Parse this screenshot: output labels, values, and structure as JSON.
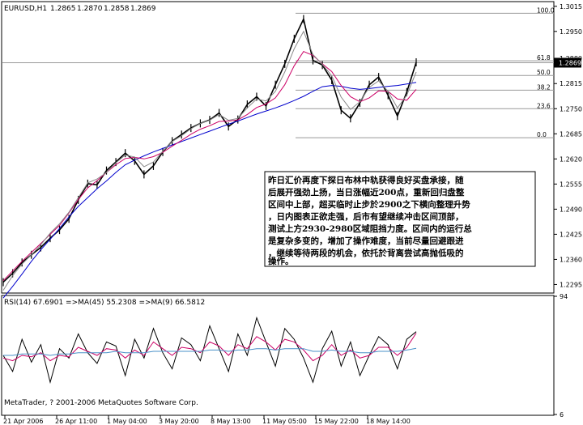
{
  "chart_data": [
    {
      "type": "candlestick",
      "panel": "price",
      "title": "EURUSD,H1",
      "ohlc_header": [
        "1.2865",
        "1.2870",
        "1.2858",
        "1.2869"
      ],
      "y_ticks": [
        "1.3015",
        "1.2950",
        "1.2880",
        "1.2815",
        "1.2750",
        "1.2685",
        "1.2620",
        "1.2555",
        "1.2490",
        "1.2425",
        "1.2360",
        "1.2295"
      ],
      "ylim": [
        1.2275,
        1.3025
      ],
      "current_price": "1.2869",
      "fibonacci": [
        {
          "label": "100.0",
          "price": 1.2997
        },
        {
          "label": "61.8",
          "price": 1.2874
        },
        {
          "label": "50.0",
          "price": 1.2836
        },
        {
          "label": "38.2",
          "price": 1.2798
        },
        {
          "label": "23.6",
          "price": 1.275
        },
        {
          "label": "0.0",
          "price": 1.2675
        }
      ],
      "series": [
        {
          "name": "price",
          "color": "#000000",
          "values": [
            1.2301,
            1.2324,
            1.2352,
            1.2372,
            1.2391,
            1.2415,
            1.2436,
            1.2465,
            1.2514,
            1.2556,
            1.2553,
            1.259,
            1.2612,
            1.2635,
            1.2615,
            1.258,
            1.2602,
            1.2638,
            1.2666,
            1.2683,
            1.27,
            1.2712,
            1.2721,
            1.2739,
            1.2704,
            1.2722,
            1.2761,
            1.2781,
            1.2757,
            1.2812,
            1.2866,
            1.2931,
            1.2982,
            1.2875,
            1.2863,
            1.2824,
            1.2746,
            1.2725,
            1.2765,
            1.2812,
            1.2832,
            1.2785,
            1.2731,
            1.2793,
            1.287
          ]
        },
        {
          "name": "",
          "color": "#0000cc",
          "values": [
            1.226,
            1.229,
            1.2322,
            1.2355,
            1.2385,
            1.2412,
            1.244,
            1.247,
            1.2497,
            1.252,
            1.2543,
            1.2563,
            1.2585,
            1.2605,
            1.2617,
            1.2628,
            1.2638,
            1.2647,
            1.2656,
            1.2665,
            1.2674,
            1.2683,
            1.2692,
            1.2701,
            1.271,
            1.2718,
            1.2727,
            1.2736,
            1.2744,
            1.2752,
            1.2761,
            1.2771,
            1.2782,
            1.2795,
            1.2807,
            1.281,
            1.2808,
            1.2803,
            1.28,
            1.2802,
            1.2805,
            1.2808,
            1.281,
            1.2814,
            1.2818
          ]
        },
        {
          "name": "",
          "color": "#cc0066",
          "values": [
            1.2305,
            1.233,
            1.2355,
            1.2378,
            1.2401,
            1.2425,
            1.2448,
            1.248,
            1.2515,
            1.2545,
            1.2564,
            1.2585,
            1.2605,
            1.2621,
            1.2624,
            1.262,
            1.2626,
            1.2637,
            1.2653,
            1.2668,
            1.2684,
            1.2697,
            1.2706,
            1.2717,
            1.2718,
            1.2721,
            1.2735,
            1.2753,
            1.2762,
            1.2778,
            1.2812,
            1.2861,
            1.2898,
            1.2888,
            1.2866,
            1.2846,
            1.281,
            1.2781,
            1.2768,
            1.2778,
            1.2796,
            1.2795,
            1.2775,
            1.2772,
            1.28
          ]
        },
        {
          "name": "",
          "color": "#888888",
          "values": [
            1.228,
            1.2318,
            1.2348,
            1.2372,
            1.2398,
            1.2428,
            1.2452,
            1.2482,
            1.252,
            1.2558,
            1.2568,
            1.2585,
            1.261,
            1.263,
            1.2625,
            1.26,
            1.2612,
            1.264,
            1.2665,
            1.268,
            1.2698,
            1.2712,
            1.272,
            1.2735,
            1.272,
            1.2725,
            1.2752,
            1.2775,
            1.277,
            1.2795,
            1.2845,
            1.2905,
            1.295,
            1.289,
            1.2865,
            1.2835,
            1.278,
            1.2748,
            1.2768,
            1.2805,
            1.2822,
            1.2795,
            1.2752,
            1.2785,
            1.2845
          ]
        }
      ],
      "annotation_lines": [
        "昨日汇价再度下探日布林中轨获得良好买盘承接，随",
        "后展开强劲上扬，当日涨幅近200点，重新回归盘整",
        "区间中上部，超买临时止步於2900之下横向整理升势",
        "，日内图表正欲走强，后市有望继续冲击区间顶部，",
        "测试上方2930-2980区域阻挡力度。区间内的运行总",
        "是复杂多变的，增加了操作难度，当前尽量回避跟进",
        "，继续等待两段的机会，依托於背离尝试高抛低吸的",
        "操作。"
      ]
    },
    {
      "type": "line",
      "panel": "indicator",
      "title": "RSI(14) 67.6901 =>MA(45) 55.2308 =>MA(9) 66.5812",
      "y_ticks": [
        "94",
        "6"
      ],
      "ylim": [
        6,
        94
      ],
      "series": [
        {
          "name": "RSI(14)",
          "color": "#000000",
          "values": [
            50,
            38,
            62,
            45,
            58,
            30,
            55,
            48,
            66,
            52,
            44,
            60,
            57,
            35,
            62,
            48,
            70,
            52,
            40,
            63,
            58,
            46,
            72,
            55,
            38,
            66,
            50,
            78,
            60,
            42,
            70,
            62,
            48,
            30,
            55,
            68,
            42,
            60,
            35,
            50,
            64,
            58,
            40,
            62,
            67.69
          ]
        },
        {
          "name": "MA(9)",
          "color": "#cc0066",
          "values": [
            48,
            46,
            50,
            49,
            52,
            46,
            50,
            49,
            56,
            53,
            50,
            55,
            54,
            48,
            54,
            50,
            60,
            55,
            50,
            56,
            55,
            52,
            60,
            57,
            50,
            58,
            55,
            64,
            60,
            54,
            62,
            60,
            54,
            46,
            50,
            58,
            50,
            54,
            48,
            50,
            56,
            56,
            50,
            56,
            66.58
          ]
        },
        {
          "name": "MA(45)",
          "color": "#4a90c8",
          "values": [
            50,
            50,
            51,
            51,
            51,
            50,
            51,
            51,
            52,
            52,
            52,
            52,
            53,
            52,
            52,
            52,
            53,
            53,
            53,
            53,
            53,
            53,
            54,
            54,
            53,
            54,
            54,
            55,
            55,
            54,
            55,
            55,
            55,
            53,
            53,
            54,
            53,
            53,
            52,
            52,
            53,
            53,
            53,
            54,
            55.23
          ]
        }
      ],
      "footer": "MetaTrader, ? 2001-2006 MetaQuotes Software Corp."
    }
  ],
  "x_axis_labels": [
    "21 Apr 2006",
    "26 Apr 11:00",
    "1 May 04:00",
    "3 May 20:00",
    "8 May 13:00",
    "11 May 05:00",
    "15 May 22:00",
    "18 May 14:00"
  ]
}
